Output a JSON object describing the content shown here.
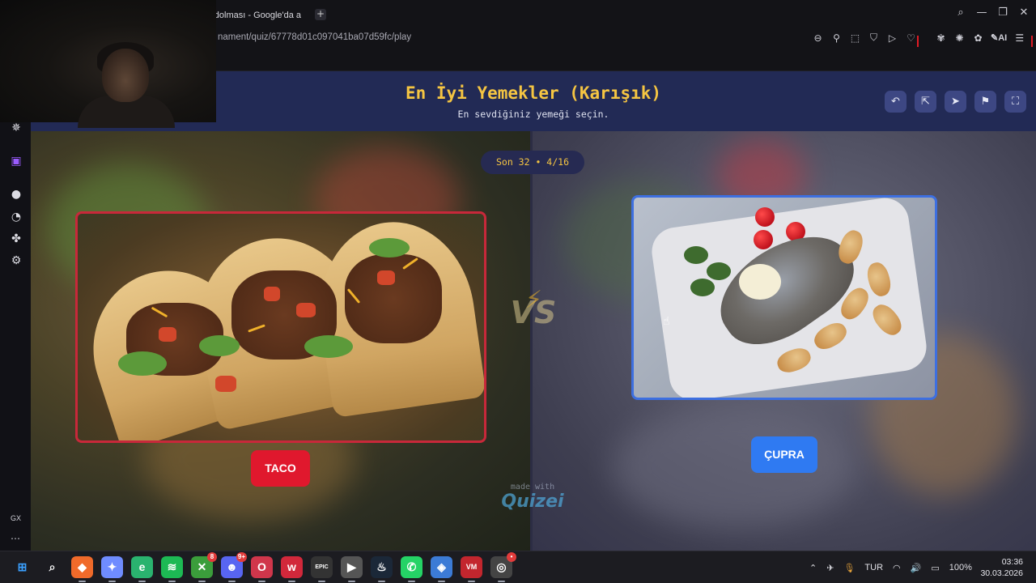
{
  "browser": {
    "tab_title": "ır dolması - Google'da a",
    "new_tab_symbol": "+",
    "url": "nament/quiz/67778d01c097041ba07d59fc/play",
    "ai_label": "AI",
    "window_controls": [
      "search-icon",
      "minimize-icon",
      "restore-icon",
      "close-icon"
    ]
  },
  "sidebar": {
    "icons": [
      "aria-icon",
      "twitch-icon",
      "spotify-icon",
      "history-icon",
      "extensions-icon",
      "settings-icon"
    ],
    "gx_label": "GX",
    "more_label": "⋯"
  },
  "quiz": {
    "title": "En İyi Yemekler (Karışık)",
    "subtitle": "En sevdiğiniz yemeği seçin.",
    "round": "Son 32 • 4/16",
    "vs_label": "VS",
    "left_choice": {
      "label": "TACO",
      "border_color": "#c8283a",
      "button_color": "#e0182d"
    },
    "right_choice": {
      "label": "ÇUPRA",
      "border_color": "#3d6fe0",
      "button_color": "#2f7af2"
    },
    "watermark_small": "made with",
    "watermark_logo": "Quizei",
    "header_buttons": [
      "undo-icon",
      "share-icon",
      "send-icon",
      "flag-icon",
      "fullscreen-icon"
    ],
    "accent_title_color": "#f5c542"
  },
  "taskbar": {
    "apps": [
      {
        "name": "start",
        "glyph": "⊞",
        "color": "#3aa0ff",
        "badge": ""
      },
      {
        "name": "search",
        "glyph": "⌕",
        "color": "#e0e0e0",
        "badge": ""
      },
      {
        "name": "brave",
        "glyph": "◆",
        "color": "#f06a2a",
        "badge": ""
      },
      {
        "name": "copilot",
        "glyph": "✦",
        "color": "#6f8cff",
        "badge": ""
      },
      {
        "name": "edge",
        "glyph": "e",
        "color": "#2ab36f",
        "badge": ""
      },
      {
        "name": "spotify",
        "glyph": "≋",
        "color": "#1db954",
        "badge": ""
      },
      {
        "name": "xbox",
        "glyph": "✕",
        "color": "#3b9d3b",
        "badge": "8"
      },
      {
        "name": "discord",
        "glyph": "☻",
        "color": "#5865f2",
        "badge": "9+"
      },
      {
        "name": "opera-gx",
        "glyph": "O",
        "color": "#d0364b",
        "badge": ""
      },
      {
        "name": "overwolf",
        "glyph": "w",
        "color": "#d2283b",
        "badge": ""
      },
      {
        "name": "epic-games",
        "glyph": "EPIC",
        "color": "#333",
        "badge": ""
      },
      {
        "name": "media-player",
        "glyph": "▶",
        "color": "#555",
        "badge": ""
      },
      {
        "name": "steam",
        "glyph": "♨",
        "color": "#1b2838",
        "badge": ""
      },
      {
        "name": "whatsapp",
        "glyph": "✆",
        "color": "#25d366",
        "badge": ""
      },
      {
        "name": "app-grid",
        "glyph": "◈",
        "color": "#3c7bd6",
        "badge": ""
      },
      {
        "name": "voicemeeter",
        "glyph": "VM",
        "color": "#c3262e",
        "badge": ""
      },
      {
        "name": "chrome-like",
        "glyph": "◎",
        "color": "#444",
        "badge": "•"
      }
    ],
    "tray": {
      "language": "TUR",
      "battery": "100%"
    },
    "clock": {
      "time": "03:36",
      "date": "30.03.2026"
    }
  }
}
